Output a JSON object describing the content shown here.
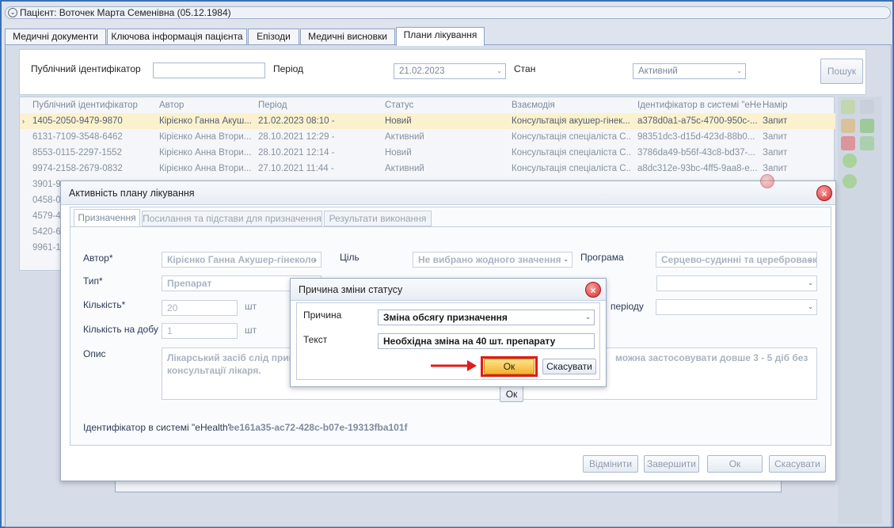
{
  "patient_bar": {
    "label": "Пацієнт: Воточек Марта Семенівна (05.12.1984)"
  },
  "tabs": [
    "Медичні документи",
    "Ключова інформація пацієнта",
    "Епізоди",
    "Медичні висновки",
    "Плани лікування"
  ],
  "filter": {
    "public_id_label": "Публічний ідентифікатор",
    "public_id_value": "",
    "period_label": "Період",
    "period_value": "21.02.2023",
    "state_label": "Стан",
    "state_value": "Активний",
    "search_button": "Пошук"
  },
  "grid": {
    "columns": [
      "Публічний ідентифікатор",
      "Автор",
      "Період",
      "Статус",
      "Взаємодія",
      "Ідентифікатор в системі \"eHe",
      "Намір"
    ],
    "rows": [
      [
        "1405-2050-9479-9870",
        "Кірієнко Ганна Акуш...",
        "21.02.2023 08:10 -",
        "Новий",
        "Консультація акушер-гінек...",
        "a378d0a1-a75c-4700-950c-...",
        "Запит"
      ],
      [
        "6131-7109-3548-6462",
        "Кірієнко Анна Втори...",
        "28.10.2021 12:29 -",
        "Активний",
        "Консультація спеціаліста С...",
        "98351dc3-d15d-423d-88b0...",
        "Запит"
      ],
      [
        "8553-0115-2297-1552",
        "Кірієнко Анна Втори...",
        "28.10.2021 12:14 -",
        "Новий",
        "Консультація спеціаліста С...",
        "3786da49-b56f-43c8-bd37-...",
        "Запит"
      ],
      [
        "9974-2158-2679-0832",
        "Кірієнко Анна Втори...",
        "27.10.2021 11:44 -",
        "Активний",
        "Консультація спеціаліста С...",
        "a8dc312e-93bc-4ff5-9aa8-e...",
        "Запит"
      ],
      [
        "3901-9",
        "",
        "",
        "",
        "",
        "",
        ""
      ],
      [
        "0458-0",
        "",
        "",
        "",
        "",
        "",
        ""
      ],
      [
        "4579-4",
        "",
        "",
        "",
        "",
        "",
        ""
      ],
      [
        "5420-6",
        "",
        "",
        "",
        "",
        "",
        ""
      ],
      [
        "9961-1",
        "",
        "",
        "",
        "",
        "",
        ""
      ]
    ]
  },
  "activity_dialog": {
    "title": "Активність плану лікування",
    "tabs": [
      "Призначення",
      "Посилання та підстави для призначення",
      "Результати виконання"
    ],
    "author_label": "Автор*",
    "author_value": "Кірієнко Ганна Акушер-гінеколо",
    "goal_label": "Ціль",
    "goal_value": "Не вибрано жодного значення",
    "program_label": "Програма",
    "program_value": "Серцево-судинні та цереброваскул",
    "type_label": "Тип*",
    "type_value": "Препарат",
    "qty_label": "Кількість*",
    "qty_value": "20",
    "qty_unit": "шт",
    "period_label": "періоду",
    "per_day_label": "Кількість на добу",
    "per_day_value": "1",
    "per_day_unit": "шт",
    "desc_label": "Опис",
    "desc_text": "Лікарський засіб слід прийм\nконсультації лікаря.",
    "desc_text_right": "можна застосовувати довше 3 - 5 діб без",
    "inner_ok": "Ок",
    "ehealth_label": "Ідентифікатор в системі \"eHealth\"",
    "ehealth_value": "ee161a35-ac72-428c-b07e-19313fba101f",
    "cancel_btn": "Відмінити",
    "complete_btn": "Завершити",
    "ok_btn": "Ок",
    "close_btn": "Скасувати"
  },
  "status_dialog": {
    "title": "Причина зміни статусу",
    "reason_label": "Причина",
    "reason_value": "Зміна обсягу призначення",
    "text_label": "Текст",
    "text_value": "Необхідна зміна на 40 шт. препарату",
    "ok_btn": "Ок",
    "cancel_btn": "Скасувати"
  },
  "colors": {
    "accent": "#3a6fb5",
    "highlight_red": "#e01b1b",
    "ok_fill": "#f5c242"
  }
}
